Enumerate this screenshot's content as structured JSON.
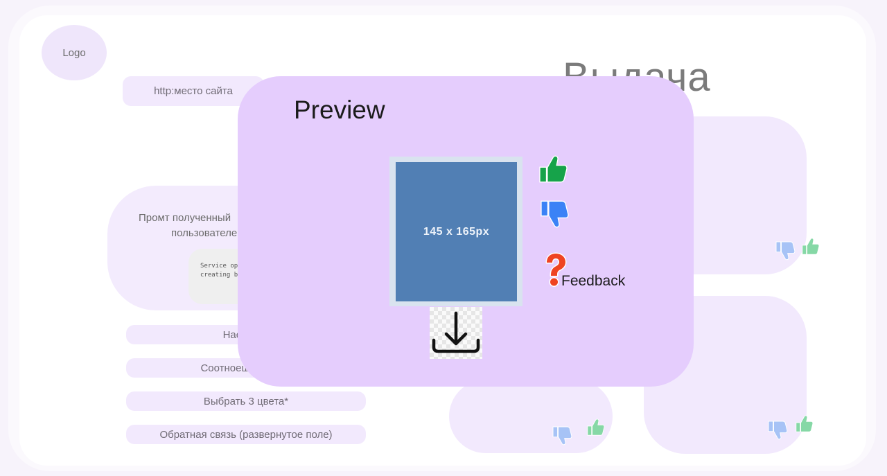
{
  "logo": {
    "label": "Logo"
  },
  "site_url": {
    "label": "http:место сайта"
  },
  "prompt_card": {
    "line1": "Промт полученный",
    "line2": "пользователе",
    "code_line1": "Service op",
    "code_line2": "creating b"
  },
  "settings": {
    "tuning_label": "Настроен",
    "aspect_label": "Соотноешние стор",
    "colors_label": "Выбрать 3 цвета*",
    "feedback_field_label": "Обратная связь (развернутое поле)"
  },
  "results": {
    "title": "Выдача"
  },
  "preview": {
    "title": "Preview",
    "image_label": "145 x 165px",
    "feedback_label": "Feedback"
  },
  "colors": {
    "overlay_bg": "#e5cdfd",
    "card_bg": "#f2e9fd",
    "like_green": "#16a34a",
    "dislike_blue": "#3b82f6",
    "question_red": "#ef4422",
    "image_blue": "#517fb4"
  },
  "icons": {
    "like": "thumbs-up-icon",
    "dislike": "thumbs-down-icon",
    "question": "question-mark-icon",
    "download": "download-icon"
  }
}
